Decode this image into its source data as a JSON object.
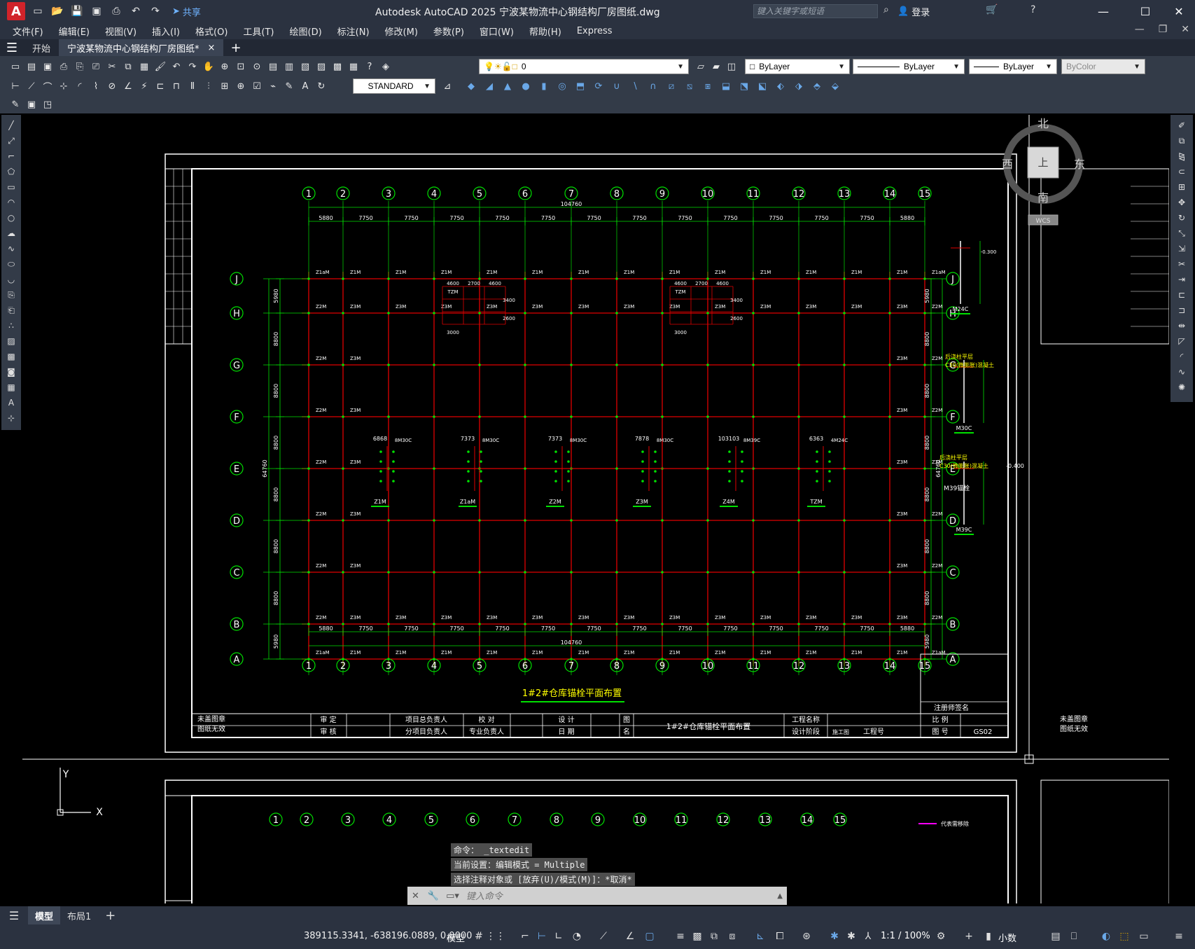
{
  "app": {
    "logo_letter": "A",
    "title": "Autodesk AutoCAD 2025    宁波某物流中心钢结构厂房图纸.dwg",
    "share_label": "共享",
    "search_placeholder": "键入关键字或短语",
    "login_label": "登录"
  },
  "menu": {
    "items": [
      "文件(F)",
      "编辑(E)",
      "视图(V)",
      "插入(I)",
      "格式(O)",
      "工具(T)",
      "绘图(D)",
      "标注(N)",
      "修改(M)",
      "参数(P)",
      "窗口(W)",
      "帮助(H)",
      "Express"
    ]
  },
  "tabs": {
    "start": "开始",
    "active_file": "宁波某物流中心钢结构厂房图纸*",
    "close": "×",
    "new": "+"
  },
  "toolbar": {
    "layer_value": "0",
    "text_style": "STANDARD",
    "color": "ByLayer",
    "linetype": "ByLayer",
    "lineweight": "ByLayer",
    "plotstyle": "ByColor"
  },
  "viewcube": {
    "north": "北",
    "south": "南",
    "east": "东",
    "west": "西",
    "top": "上",
    "wcs": "WCS"
  },
  "drawing": {
    "col_axes": [
      "1",
      "2",
      "3",
      "4",
      "5",
      "6",
      "7",
      "8",
      "9",
      "10",
      "11",
      "12",
      "13",
      "14",
      "15"
    ],
    "row_axes": [
      "J",
      "H",
      "G",
      "F",
      "E",
      "D",
      "C",
      "B",
      "A"
    ],
    "col_dims": [
      "5880",
      "7750",
      "7750",
      "7750",
      "7750",
      "7750",
      "7750",
      "7750",
      "7750",
      "7750",
      "7750",
      "7750",
      "7750",
      "5880"
    ],
    "total_width": "104760",
    "row_dims": [
      "5980",
      "8800",
      "8800",
      "8800",
      "8800",
      "8800",
      "8800",
      "5980"
    ],
    "total_height": "64760",
    "plan_title": "1#2#仓库锚栓平面布置",
    "detail_labels": [
      "Z1M",
      "Z1aM",
      "Z2M",
      "Z3M",
      "Z4M",
      "TZM"
    ],
    "detail_dims": [
      "6868",
      "7373",
      "7373",
      "7878",
      "103103",
      "6363"
    ],
    "detail_bolts": [
      "8M30C",
      "8M30C",
      "8M30C",
      "8M30C",
      "8M39C",
      "4M24C"
    ],
    "bolt_details": [
      "M24C",
      "M30C",
      "M39C"
    ],
    "bolt_notes": [
      "-0.300",
      "后浇柱平层",
      "C30(微膨胀)混凝土",
      "-0.400",
      "M39锚栓",
      "4600",
      "2700",
      "3000",
      "3400",
      "2600"
    ],
    "title_block": {
      "unsigned": "未盖图章 图纸无效",
      "review": "审 定",
      "check": "审 核",
      "project_lead": "项目总负责人",
      "sub_lead": "分项目负责人",
      "verify": "校 对",
      "discipline_lead": "专业负责人",
      "design": "设 计",
      "date": "日 期",
      "drawing_name_label": "图 名",
      "drawing_name": "1#2#仓库锚栓平面布置",
      "project_name": "工程名称",
      "design_stage": "设计阶段",
      "stage_value": "施工图",
      "project_no": "工程号",
      "scale": "比 例",
      "drawing_no_label": "图 号",
      "drawing_no": "GS02",
      "reg_sign": "注册师签名"
    },
    "legend_note": "代表需移除"
  },
  "command": {
    "history": [
      "命令： _textedit",
      "当前设置：编辑模式 = Multiple",
      "选择注释对象或 [放弃(U)/模式(M)]：*取消*"
    ],
    "placeholder": "键入命令"
  },
  "layouts": {
    "model": "模型",
    "layout1": "布局1",
    "add": "+"
  },
  "status": {
    "coords": "389115.3341, -638196.0889, 0.0000",
    "model": "模型",
    "scale": "1:1 / 100%",
    "units": "小数"
  }
}
